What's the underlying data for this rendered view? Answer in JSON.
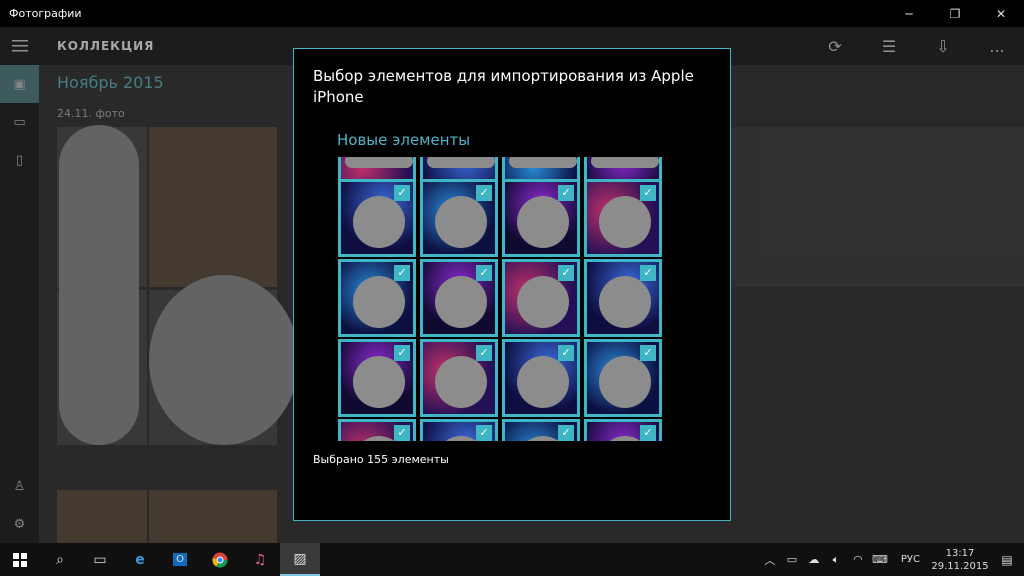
{
  "window": {
    "title": "Фотографии",
    "minimize_icon": "minimize-icon",
    "restore_icon": "restore-icon",
    "close_icon": "close-icon"
  },
  "appbar": {
    "heading": "КОЛЛЕКЦИЯ",
    "tools": [
      "refresh-icon",
      "select-icon",
      "import-icon",
      "more-icon"
    ],
    "more_label": "..."
  },
  "sidenav": {
    "items": [
      "collection-icon",
      "albums-icon",
      "folders-icon"
    ],
    "bottom": [
      "account-icon",
      "settings-icon"
    ]
  },
  "collection": {
    "month": "Ноябрь 2015",
    "date_caption": "24.11.   фото"
  },
  "dialog": {
    "title": "Выбор элементов для импортирования из Apple iPhone",
    "section": "Новые элементы",
    "status": "Выбрано 155 элементы",
    "checkmark": "✓"
  },
  "taskbar": {
    "apps": [
      "start-icon",
      "search-icon",
      "task-view-icon",
      "edge-icon",
      "outlook-icon",
      "chrome-icon",
      "itunes-icon",
      "photos-icon"
    ],
    "language": "РУС",
    "time": "13:17",
    "date": "29.11.2015"
  },
  "colors": {
    "accent": "#3fb6c4",
    "section_text": "#4fb3c9",
    "month_text": "#6fbfc4"
  }
}
